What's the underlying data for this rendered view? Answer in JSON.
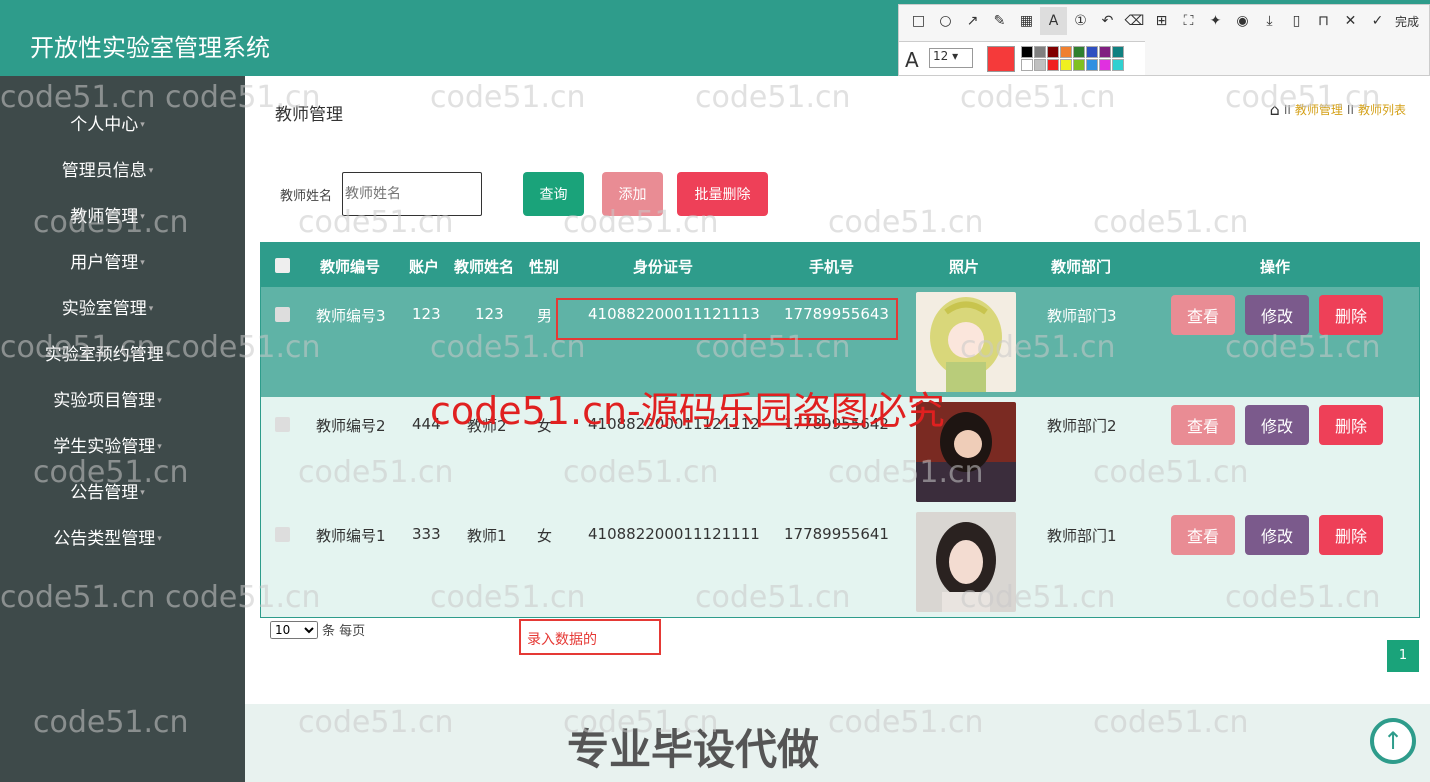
{
  "header": {
    "title": "开放性实验室管理系统"
  },
  "sidebar": {
    "items": [
      {
        "label": "个人中心"
      },
      {
        "label": "管理员信息"
      },
      {
        "label": "教师管理"
      },
      {
        "label": "用户管理"
      },
      {
        "label": "实验室管理"
      },
      {
        "label": "实验室预约管理"
      },
      {
        "label": "实验项目管理"
      },
      {
        "label": "学生实验管理"
      },
      {
        "label": "公告管理"
      },
      {
        "label": "公告类型管理"
      }
    ]
  },
  "page": {
    "title": "教师管理",
    "breadcrumb": [
      "教师管理",
      "教师列表"
    ],
    "separator": "II"
  },
  "search": {
    "label": "教师姓名",
    "placeholder": "教师姓名"
  },
  "buttons": {
    "query": "查询",
    "add": "添加",
    "batch_delete": "批量删除"
  },
  "table": {
    "headers": [
      "教师编号",
      "账户",
      "教师姓名",
      "性别",
      "身份证号",
      "手机号",
      "照片",
      "教师部门",
      "操作"
    ],
    "rows": [
      {
        "id": "教师编号3",
        "account": "123",
        "name": "123",
        "gender": "男",
        "idcard": "410882200011121113",
        "phone": "17789955643",
        "dept": "教师部门3"
      },
      {
        "id": "教师编号2",
        "account": "444",
        "name": "教师2",
        "gender": "女",
        "idcard": "410882200011121112",
        "phone": "17789955642",
        "dept": "教师部门2"
      },
      {
        "id": "教师编号1",
        "account": "333",
        "name": "教师1",
        "gender": "女",
        "idcard": "410882200011121111",
        "phone": "17789955641",
        "dept": "教师部门1"
      }
    ],
    "actions": {
      "view": "查看",
      "edit": "修改",
      "delete": "删除"
    }
  },
  "pagination": {
    "page_size": "10",
    "suffix": "条 每页",
    "current_page": "1"
  },
  "annotation": {
    "note_text": "录入数据的"
  },
  "footer": {
    "promo": "专业毕设代做"
  },
  "watermark": {
    "text": "code51.cn",
    "red_text": "code51.cn-源码乐园盗图必究"
  },
  "toolbar": {
    "finish_label": "完成",
    "font_size": "12"
  },
  "colors": {
    "primary": "#2e9c8b",
    "sidebar": "#3e4a4a",
    "danger": "#ee4058",
    "pink": "#e98c94",
    "purple": "#7b5a8c",
    "green": "#1aa37a"
  }
}
